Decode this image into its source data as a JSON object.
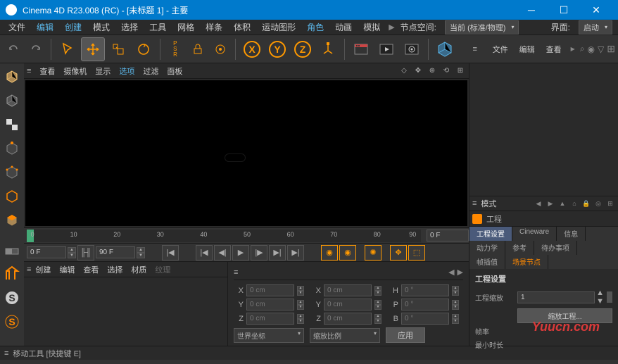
{
  "title": "Cinema 4D R23.008 (RC) - [未标题 1] - 主要",
  "menu": {
    "file": "文件",
    "edit": "编辑",
    "create": "创建",
    "mode": "模式",
    "select": "选择",
    "tool": "工具",
    "mesh": "网格",
    "spline": "样条",
    "volume": "体积",
    "mograph": "运动图形",
    "character": "角色",
    "animate": "动画",
    "simulate": "模拟",
    "nodespace": "节点空间:",
    "nodespace_value": "当前 (标准/物理)",
    "layout": "界面:",
    "layout_value": "启动"
  },
  "viewport": {
    "view": "查看",
    "camera": "摄像机",
    "display": "显示",
    "options": "选项",
    "filter": "过滤",
    "panel": "面板"
  },
  "timeline": {
    "ticks": [
      "0",
      "10",
      "20",
      "30",
      "40",
      "50",
      "60",
      "70",
      "80",
      "90"
    ],
    "current_frame": "0 F",
    "start_frame": "0 F",
    "end_frame": "90 F"
  },
  "materials": {
    "create": "创建",
    "edit": "编辑",
    "view": "查看",
    "select": "选择",
    "material": "材质",
    "texture": "纹理"
  },
  "coords": {
    "x_label": "X",
    "y_label": "Y",
    "z_label": "Z",
    "x2_label": "X",
    "y2_label": "Y",
    "z2_label": "Z",
    "h_label": "H",
    "p_label": "P",
    "b_label": "B",
    "pos_x": "0 cm",
    "pos_y": "0 cm",
    "pos_z": "0 cm",
    "size_x": "0 cm",
    "size_y": "0 cm",
    "size_z": "0 cm",
    "rot_h": "0 °",
    "rot_p": "0 °",
    "rot_b": "0 °",
    "world": "世界坐标",
    "scale": "缩放比例",
    "apply": "应用"
  },
  "objmgr": {
    "file": "文件",
    "edit": "编辑",
    "view": "查看"
  },
  "attr": {
    "mode": "模式",
    "project": "工程",
    "tab_proj": "工程设置",
    "tab_cine": "Cineware",
    "tab_info": "信息",
    "tab_dyn": "动力学",
    "tab_ref": "参考",
    "tab_todo": "待办事项",
    "tab_interp": "帧插值",
    "tab_scene": "场景节点",
    "section": "工程设置",
    "scale_label": "工程缩放",
    "scale_value": "1",
    "compress": "缩放工程...",
    "fps_label": "帧率",
    "mintime_label": "最小时长"
  },
  "status": "移动工具 [快捷键 E]",
  "watermark": "Yuucn.com"
}
